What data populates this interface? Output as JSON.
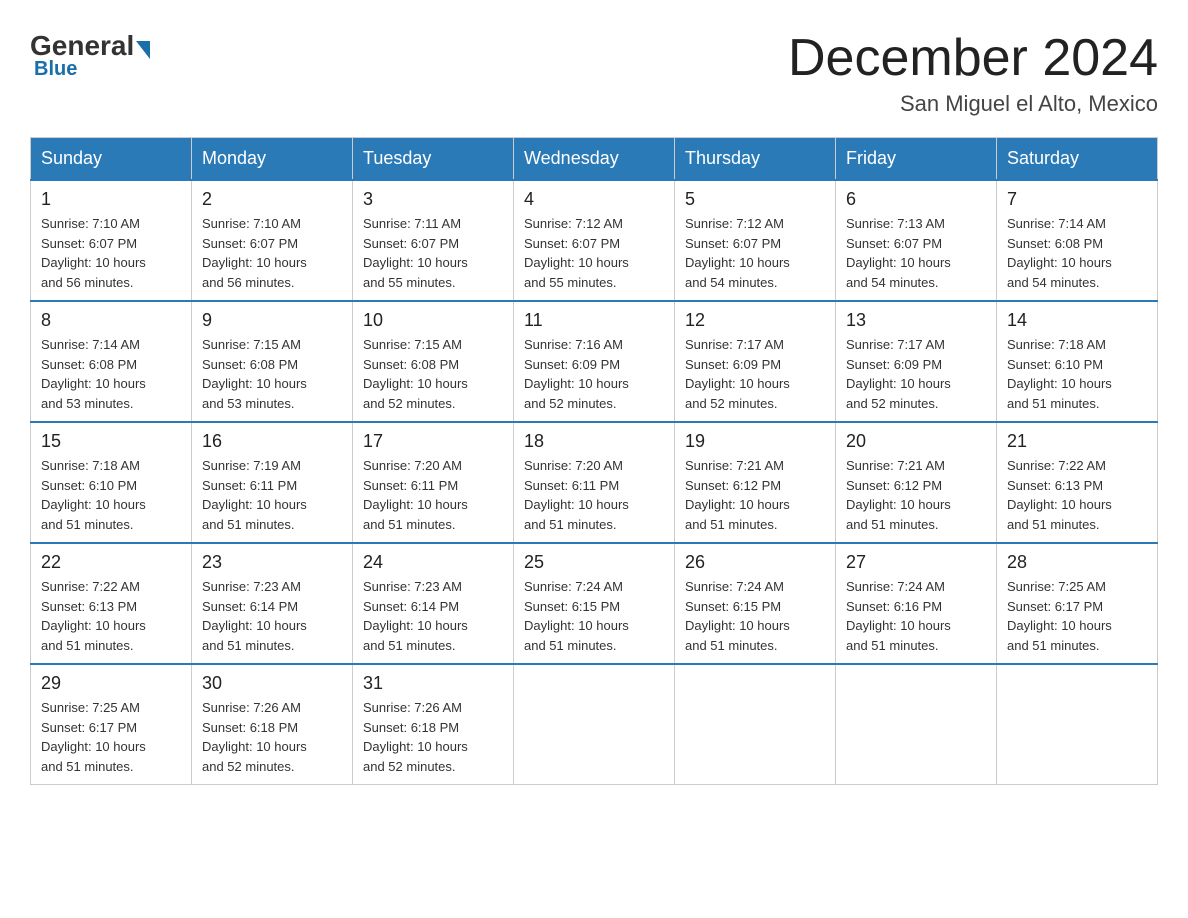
{
  "logo": {
    "general": "General",
    "blue": "Blue"
  },
  "title": "December 2024",
  "location": "San Miguel el Alto, Mexico",
  "days_of_week": [
    "Sunday",
    "Monday",
    "Tuesday",
    "Wednesday",
    "Thursday",
    "Friday",
    "Saturday"
  ],
  "weeks": [
    [
      {
        "day": "1",
        "info": "Sunrise: 7:10 AM\nSunset: 6:07 PM\nDaylight: 10 hours\nand 56 minutes."
      },
      {
        "day": "2",
        "info": "Sunrise: 7:10 AM\nSunset: 6:07 PM\nDaylight: 10 hours\nand 56 minutes."
      },
      {
        "day": "3",
        "info": "Sunrise: 7:11 AM\nSunset: 6:07 PM\nDaylight: 10 hours\nand 55 minutes."
      },
      {
        "day": "4",
        "info": "Sunrise: 7:12 AM\nSunset: 6:07 PM\nDaylight: 10 hours\nand 55 minutes."
      },
      {
        "day": "5",
        "info": "Sunrise: 7:12 AM\nSunset: 6:07 PM\nDaylight: 10 hours\nand 54 minutes."
      },
      {
        "day": "6",
        "info": "Sunrise: 7:13 AM\nSunset: 6:07 PM\nDaylight: 10 hours\nand 54 minutes."
      },
      {
        "day": "7",
        "info": "Sunrise: 7:14 AM\nSunset: 6:08 PM\nDaylight: 10 hours\nand 54 minutes."
      }
    ],
    [
      {
        "day": "8",
        "info": "Sunrise: 7:14 AM\nSunset: 6:08 PM\nDaylight: 10 hours\nand 53 minutes."
      },
      {
        "day": "9",
        "info": "Sunrise: 7:15 AM\nSunset: 6:08 PM\nDaylight: 10 hours\nand 53 minutes."
      },
      {
        "day": "10",
        "info": "Sunrise: 7:15 AM\nSunset: 6:08 PM\nDaylight: 10 hours\nand 52 minutes."
      },
      {
        "day": "11",
        "info": "Sunrise: 7:16 AM\nSunset: 6:09 PM\nDaylight: 10 hours\nand 52 minutes."
      },
      {
        "day": "12",
        "info": "Sunrise: 7:17 AM\nSunset: 6:09 PM\nDaylight: 10 hours\nand 52 minutes."
      },
      {
        "day": "13",
        "info": "Sunrise: 7:17 AM\nSunset: 6:09 PM\nDaylight: 10 hours\nand 52 minutes."
      },
      {
        "day": "14",
        "info": "Sunrise: 7:18 AM\nSunset: 6:10 PM\nDaylight: 10 hours\nand 51 minutes."
      }
    ],
    [
      {
        "day": "15",
        "info": "Sunrise: 7:18 AM\nSunset: 6:10 PM\nDaylight: 10 hours\nand 51 minutes."
      },
      {
        "day": "16",
        "info": "Sunrise: 7:19 AM\nSunset: 6:11 PM\nDaylight: 10 hours\nand 51 minutes."
      },
      {
        "day": "17",
        "info": "Sunrise: 7:20 AM\nSunset: 6:11 PM\nDaylight: 10 hours\nand 51 minutes."
      },
      {
        "day": "18",
        "info": "Sunrise: 7:20 AM\nSunset: 6:11 PM\nDaylight: 10 hours\nand 51 minutes."
      },
      {
        "day": "19",
        "info": "Sunrise: 7:21 AM\nSunset: 6:12 PM\nDaylight: 10 hours\nand 51 minutes."
      },
      {
        "day": "20",
        "info": "Sunrise: 7:21 AM\nSunset: 6:12 PM\nDaylight: 10 hours\nand 51 minutes."
      },
      {
        "day": "21",
        "info": "Sunrise: 7:22 AM\nSunset: 6:13 PM\nDaylight: 10 hours\nand 51 minutes."
      }
    ],
    [
      {
        "day": "22",
        "info": "Sunrise: 7:22 AM\nSunset: 6:13 PM\nDaylight: 10 hours\nand 51 minutes."
      },
      {
        "day": "23",
        "info": "Sunrise: 7:23 AM\nSunset: 6:14 PM\nDaylight: 10 hours\nand 51 minutes."
      },
      {
        "day": "24",
        "info": "Sunrise: 7:23 AM\nSunset: 6:14 PM\nDaylight: 10 hours\nand 51 minutes."
      },
      {
        "day": "25",
        "info": "Sunrise: 7:24 AM\nSunset: 6:15 PM\nDaylight: 10 hours\nand 51 minutes."
      },
      {
        "day": "26",
        "info": "Sunrise: 7:24 AM\nSunset: 6:15 PM\nDaylight: 10 hours\nand 51 minutes."
      },
      {
        "day": "27",
        "info": "Sunrise: 7:24 AM\nSunset: 6:16 PM\nDaylight: 10 hours\nand 51 minutes."
      },
      {
        "day": "28",
        "info": "Sunrise: 7:25 AM\nSunset: 6:17 PM\nDaylight: 10 hours\nand 51 minutes."
      }
    ],
    [
      {
        "day": "29",
        "info": "Sunrise: 7:25 AM\nSunset: 6:17 PM\nDaylight: 10 hours\nand 51 minutes."
      },
      {
        "day": "30",
        "info": "Sunrise: 7:26 AM\nSunset: 6:18 PM\nDaylight: 10 hours\nand 52 minutes."
      },
      {
        "day": "31",
        "info": "Sunrise: 7:26 AM\nSunset: 6:18 PM\nDaylight: 10 hours\nand 52 minutes."
      },
      null,
      null,
      null,
      null
    ]
  ]
}
